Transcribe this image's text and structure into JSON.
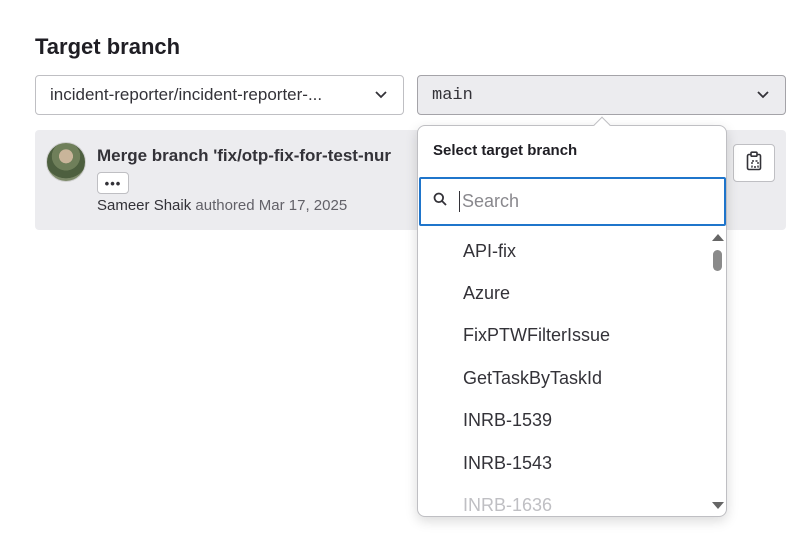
{
  "section": {
    "title": "Target branch"
  },
  "source_select": {
    "value": "incident-reporter/incident-reporter-..."
  },
  "target_select": {
    "value": "main"
  },
  "commit": {
    "title": "Merge branch 'fix/otp-fix-for-test-nur",
    "ellipsis": "•••",
    "author": "Sameer Shaik",
    "meta": "authored Mar 17, 2025"
  },
  "dropdown": {
    "header": "Select target branch",
    "search_placeholder": "Search",
    "items": [
      "API-fix",
      "Azure",
      "FixPTWFilterIssue",
      "GetTaskByTaskId",
      "INRB-1539",
      "INRB-1543",
      "INRB-1636"
    ]
  },
  "icons": {
    "chevron": "chevron-down-icon",
    "search": "search-icon",
    "copy": "copy-to-clipboard-icon"
  },
  "colors": {
    "focus": "#1f75cb",
    "panel_bg": "#ececef"
  }
}
